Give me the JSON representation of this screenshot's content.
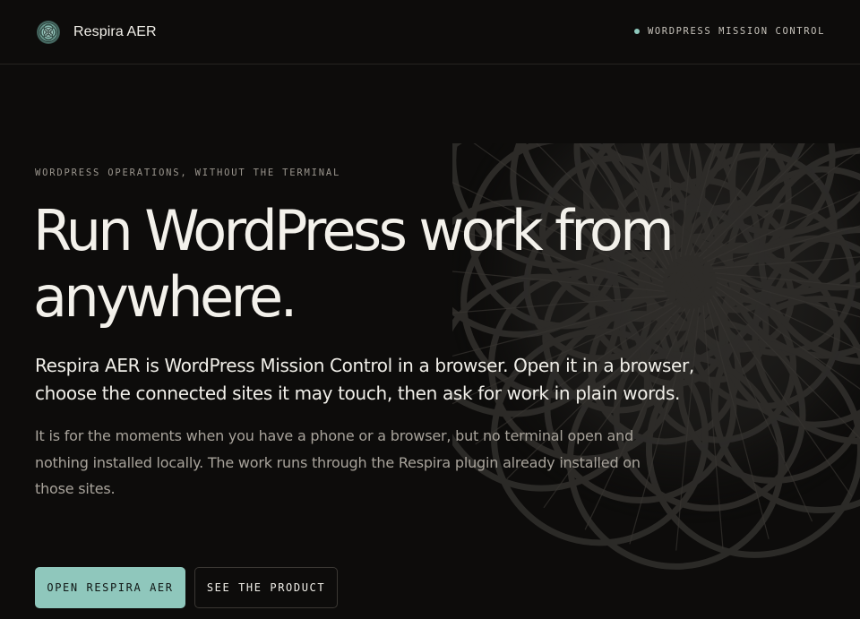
{
  "header": {
    "brand_name": "Respira AER",
    "logo_icon": "rose-emblem-icon",
    "status_label": "WORDPRESS MISSION CONTROL",
    "status_color": "#8ec9bd"
  },
  "hero": {
    "eyebrow": "WORDPRESS OPERATIONS, WITHOUT THE TERMINAL",
    "headline": "Run WordPress work from anywhere.",
    "lead": "Respira AER is WordPress Mission Control in a browser. Open it in a browser, choose the connected sites it may touch, then ask for work in plain words.",
    "body": "It is for the moments when you have a phone or a browser, but no terminal open and nothing installed locally. The work runs through the Respira plugin already installed on those sites."
  },
  "actions": {
    "primary_label": "OPEN RESPIRA AER",
    "secondary_label": "SEE THE PRODUCT"
  },
  "colors": {
    "background": "#0d0c0b",
    "accent": "#8fc7bc",
    "text": "#f1efe9",
    "muted": "#a8a39b"
  },
  "decoration": {
    "background_art": "rose-pattern-icon"
  }
}
